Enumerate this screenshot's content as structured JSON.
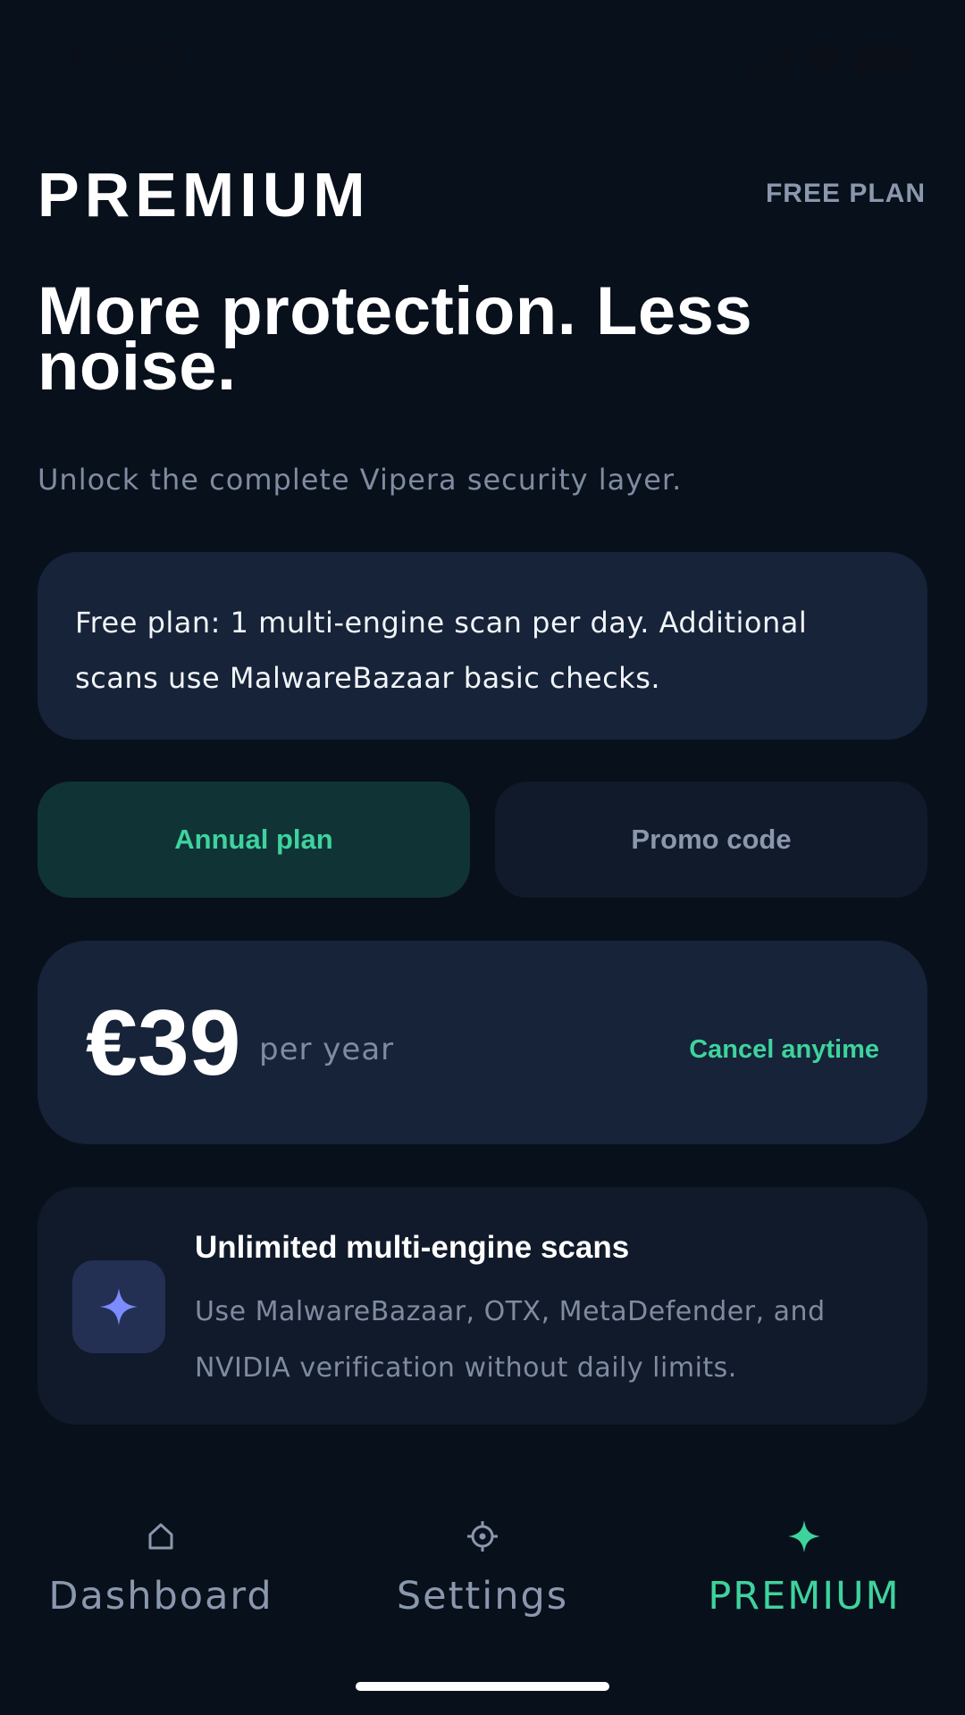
{
  "status_bar": {
    "time": "1:09"
  },
  "header": {
    "title": "PREMIUM",
    "plan_tag": "FREE PLAN"
  },
  "hero": {
    "headline": "More protection. Less noise.",
    "subhead": "Unlock the complete Vipera security layer."
  },
  "info_card": {
    "text": "Free plan: 1 multi-engine scan per day. Additional scans use MalwareBazaar basic checks."
  },
  "plan_toggle": {
    "annual_label": "Annual plan",
    "promo_label": "Promo code",
    "selected": "Annual plan"
  },
  "price": {
    "amount": "€39",
    "period": "per year",
    "note": "Cancel anytime"
  },
  "feature": {
    "icon": "sparkle-icon",
    "title": "Unlimited multi-engine scans",
    "description": "Use MalwareBazaar, OTX, MetaDefender, and NVIDIA verification without daily limits."
  },
  "bottom_nav": {
    "items": [
      {
        "label": "Dashboard",
        "icon": "home-icon"
      },
      {
        "label": "Settings",
        "icon": "gear-icon"
      },
      {
        "label": "PREMIUM",
        "icon": "sparkle-icon"
      }
    ],
    "active": "PREMIUM"
  },
  "colors": {
    "background": "#08101c",
    "card": "#162338",
    "card_dark": "#111a2a",
    "accent": "#3ed39d",
    "accent_bg": "#103336",
    "muted": "#8a97ad",
    "feature_icon": "#7c8cff"
  }
}
